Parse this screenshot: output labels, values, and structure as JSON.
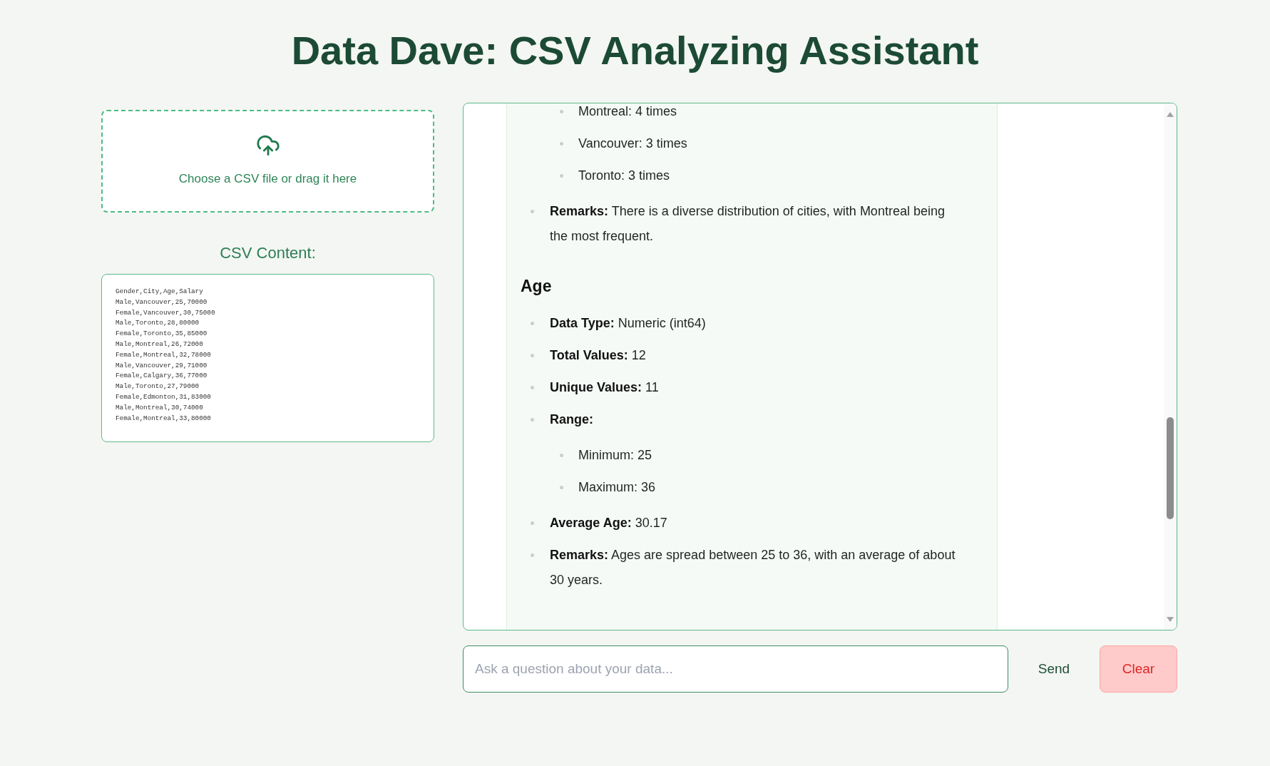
{
  "title": "Data Dave: CSV Analyzing Assistant",
  "upload": {
    "label": "Choose a CSV file or drag it here"
  },
  "csv_content": {
    "heading": "CSV Content:",
    "lines": [
      "Gender,City,Age,Salary",
      "Male,Vancouver,25,70000",
      "Female,Vancouver,30,75000",
      "Male,Toronto,28,80000",
      "Female,Toronto,35,85000",
      "Male,Montreal,26,72000",
      "Female,Montreal,32,78000",
      "Male,Vancouver,29,71000",
      "Female,Calgary,36,77000",
      "Male,Toronto,27,79000",
      "Female,Edmonton,31,83000",
      "Male,Montreal,30,74000",
      "Female,Montreal,33,80000"
    ]
  },
  "chat": {
    "messages": [
      {
        "blocks": [
          {
            "kind": "list",
            "items": [
              {
                "children": [
                  {
                    "text": "Montreal: 4 times"
                  },
                  {
                    "text": "Vancouver: 3 times"
                  },
                  {
                    "text": "Toronto: 3 times"
                  }
                ]
              },
              {
                "label": "Remarks:",
                "text": "There is a diverse distribution of cities, with Montreal being the most frequent."
              }
            ]
          },
          {
            "kind": "heading",
            "text": "Age"
          },
          {
            "kind": "list",
            "items": [
              {
                "label": "Data Type:",
                "text": "Numeric (int64)"
              },
              {
                "label": "Total Values:",
                "text": "12"
              },
              {
                "label": "Unique Values:",
                "text": "11"
              },
              {
                "label": "Range:",
                "children": [
                  {
                    "text": "Minimum: 25"
                  },
                  {
                    "text": "Maximum: 36"
                  }
                ]
              },
              {
                "label": "Average Age:",
                "text": "30.17"
              },
              {
                "label": "Remarks:",
                "text": "Ages are spread between 25 to 36, with an average of about 30 years."
              }
            ]
          }
        ]
      }
    ]
  },
  "composer": {
    "placeholder": "Ask a question about your data...",
    "buttons": [
      {
        "label": "Send",
        "kind": "plain"
      },
      {
        "label": "Clear",
        "kind": "danger"
      }
    ]
  }
}
